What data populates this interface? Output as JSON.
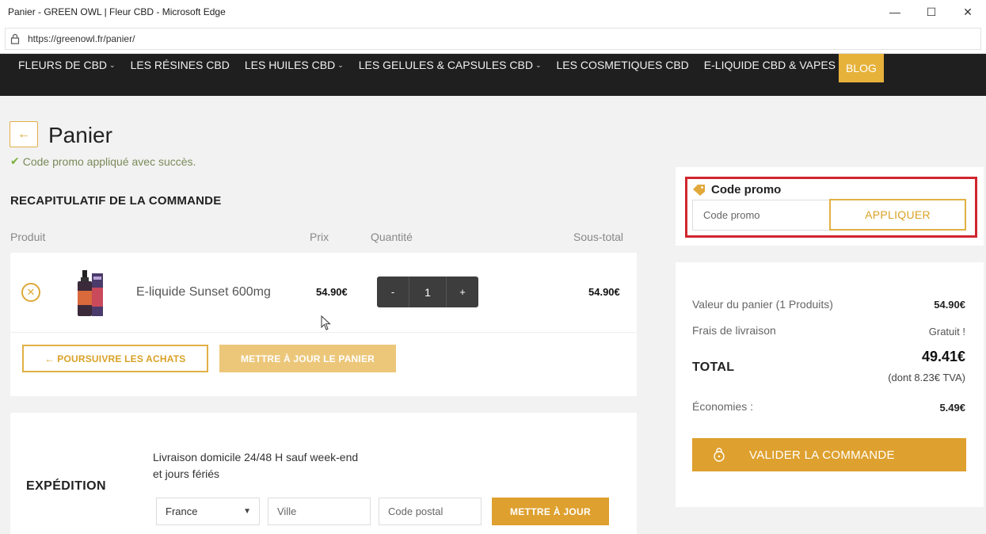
{
  "window": {
    "title": "Panier - GREEN OWL | Fleur CBD - Microsoft Edge",
    "url": "https://greenowl.fr/panier/"
  },
  "nav": {
    "items": [
      {
        "label": "FLEURS DE CBD",
        "dropdown": true
      },
      {
        "label": "LES RÉSINES CBD",
        "dropdown": false
      },
      {
        "label": "LES HUILES CBD",
        "dropdown": true
      },
      {
        "label": "LES GELULES & CAPSULES CBD",
        "dropdown": true
      },
      {
        "label": "LES COSMETIQUES CBD",
        "dropdown": false
      },
      {
        "label": "E-LIQUIDE CBD & VAPES",
        "dropdown": true
      }
    ],
    "blog_label": "BLOG"
  },
  "page": {
    "title": "Panier",
    "success_message": "Code promo appliqué avec succès."
  },
  "summary": {
    "title": "RECAPITULATIF DE LA COMMANDE",
    "columns": {
      "product": "Produit",
      "price": "Prix",
      "quantity": "Quantité",
      "subtotal": "Sous-total"
    },
    "item": {
      "name": "E-liquide Sunset 600mg",
      "price": "54.90€",
      "quantity": "1",
      "subtotal": "54.90€",
      "qty_minus": "-",
      "qty_plus": "+"
    },
    "continue_label": "← POURSUIVRE LES ACHATS",
    "update_label": "METTRE À JOUR LE PANIER"
  },
  "shipping": {
    "title": "EXPÉDITION",
    "description": "Livraison domicile 24/48 H sauf week-end et jours fériés",
    "country": "France",
    "city_placeholder": "Ville",
    "zip_placeholder": "Code postal",
    "update_label": "METTRE À JOUR"
  },
  "promo": {
    "label": "Code promo",
    "placeholder": "Code promo",
    "apply_label": "APPLIQUER"
  },
  "totals": {
    "cart_value_label": "Valeur du panier (1 Produits)",
    "cart_value": "54.90€",
    "shipping_label": "Frais de livraison",
    "shipping_value": "Gratuit !",
    "total_label": "TOTAL",
    "total_value": "49.41€",
    "tva_note": "(dont 8.23€ TVA)",
    "savings_label": "Économies :",
    "savings_value": "5.49€",
    "validate_label": "VALIDER LA COMMANDE"
  },
  "colors": {
    "accent": "#dea02e",
    "highlight": "#d0262e",
    "nav_bg": "#1f1f1f"
  }
}
